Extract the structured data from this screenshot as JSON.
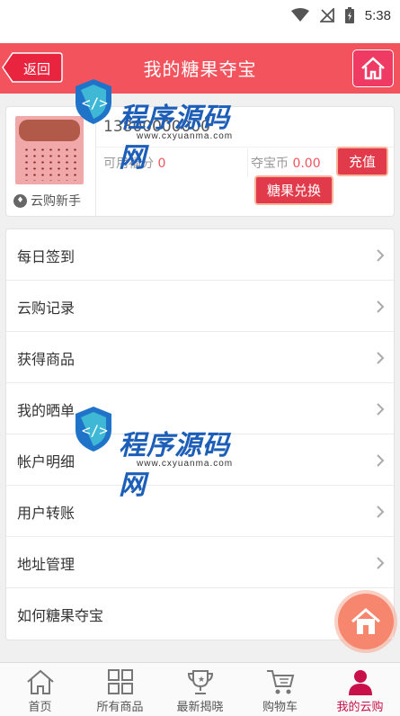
{
  "status_bar": {
    "time": "5:38",
    "icons": [
      "wifi-icon",
      "no-signal-icon",
      "battery-charging-icon"
    ]
  },
  "header": {
    "back_label": "返回",
    "title": "我的糖果夺宝",
    "home_icon": "home-icon",
    "bg_color": "#f3535d"
  },
  "profile": {
    "phone": "13800000000",
    "level_label": "云购新手",
    "fufen_label": "可用福分",
    "fufen_value": "0",
    "duobao_label": "夺宝币",
    "duobao_value": "0.00",
    "recharge_label": "充值",
    "exchange_label": "糖果兑换"
  },
  "menu": {
    "items": [
      {
        "label": "每日签到"
      },
      {
        "label": "云购记录"
      },
      {
        "label": "获得商品"
      },
      {
        "label": "我的晒单"
      },
      {
        "label": "帐户明细"
      },
      {
        "label": "用户转账"
      },
      {
        "label": "地址管理"
      },
      {
        "label": "如何糖果夺宝"
      }
    ]
  },
  "tabbar": {
    "items": [
      {
        "label": "首页",
        "icon": "home-outline-icon"
      },
      {
        "label": "所有商品",
        "icon": "grid-icon"
      },
      {
        "label": "最新揭晓",
        "icon": "trophy-icon"
      },
      {
        "label": "购物车",
        "icon": "cart-icon"
      },
      {
        "label": "我的云购",
        "icon": "user-icon"
      }
    ],
    "active_color": "#c8104a"
  },
  "watermark": {
    "text": "程序源码网",
    "url": "www.cxyuanma.com"
  }
}
